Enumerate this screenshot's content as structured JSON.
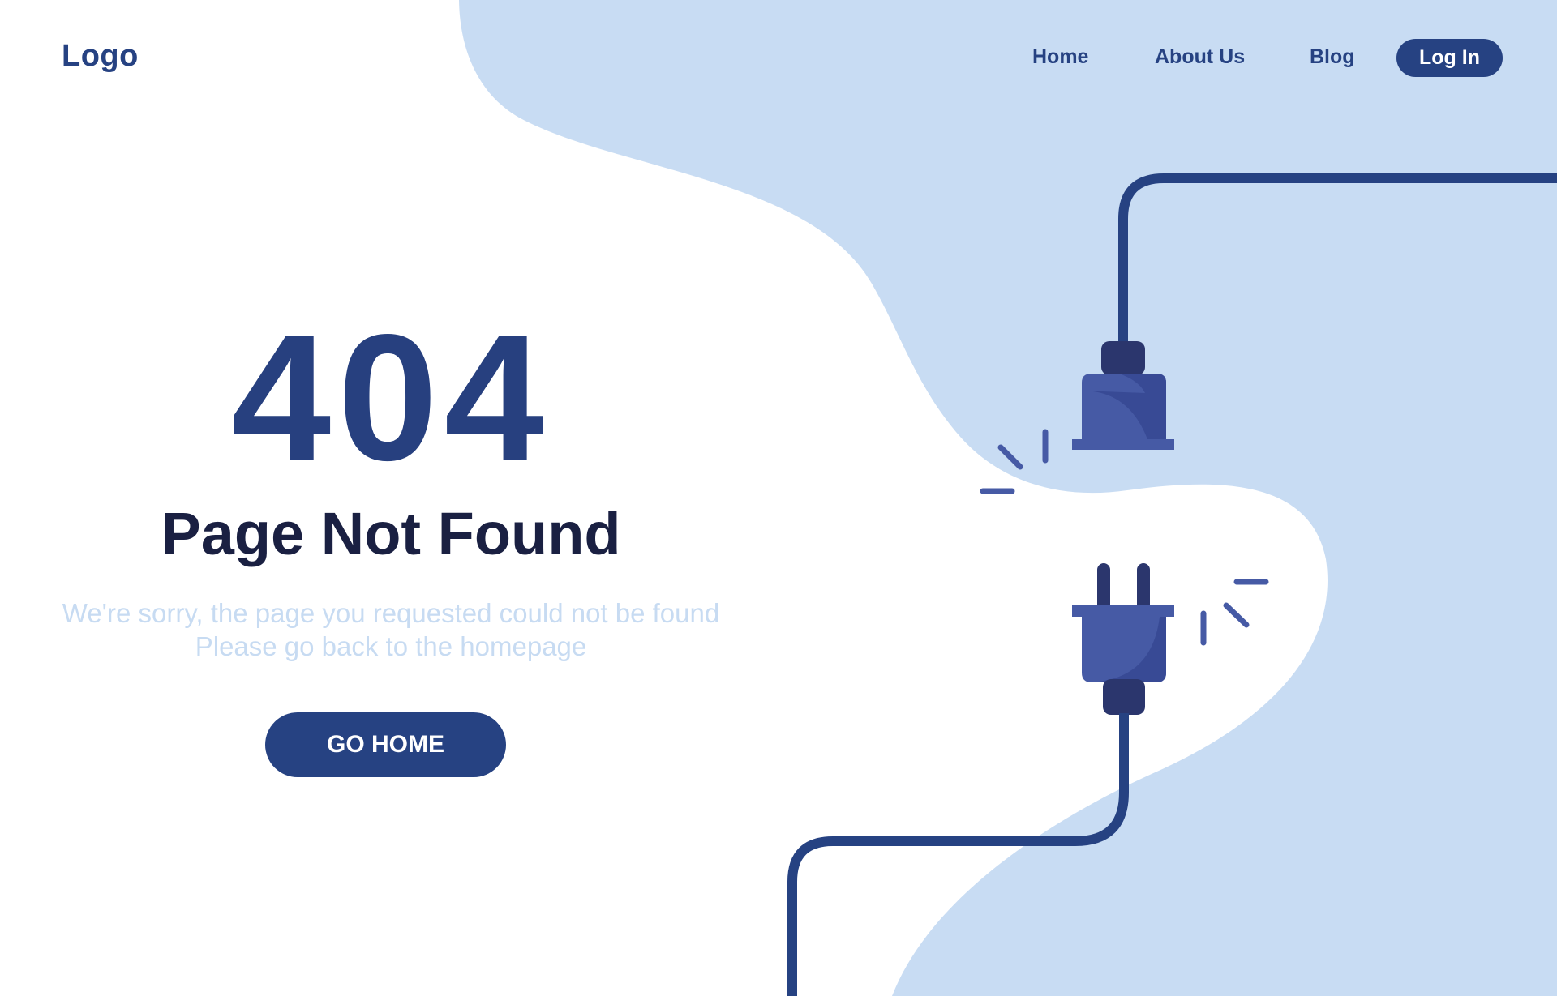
{
  "header": {
    "logo": "Logo",
    "nav": {
      "home": "Home",
      "about": "About Us",
      "blog": "Blog",
      "login": "Log In"
    }
  },
  "hero": {
    "code": "404",
    "title": "Page Not Found",
    "message_line1": "We're sorry, the page you requested could not be found",
    "message_line2": "Please go back to the homepage",
    "button": "GO HOME"
  },
  "colors": {
    "brand": "#264282",
    "light_blue": "#c8dcf3",
    "title": "#1a2042",
    "plug": "#465aa5"
  },
  "icons": {
    "socket": "power-socket-icon",
    "plug": "power-plug-icon"
  }
}
